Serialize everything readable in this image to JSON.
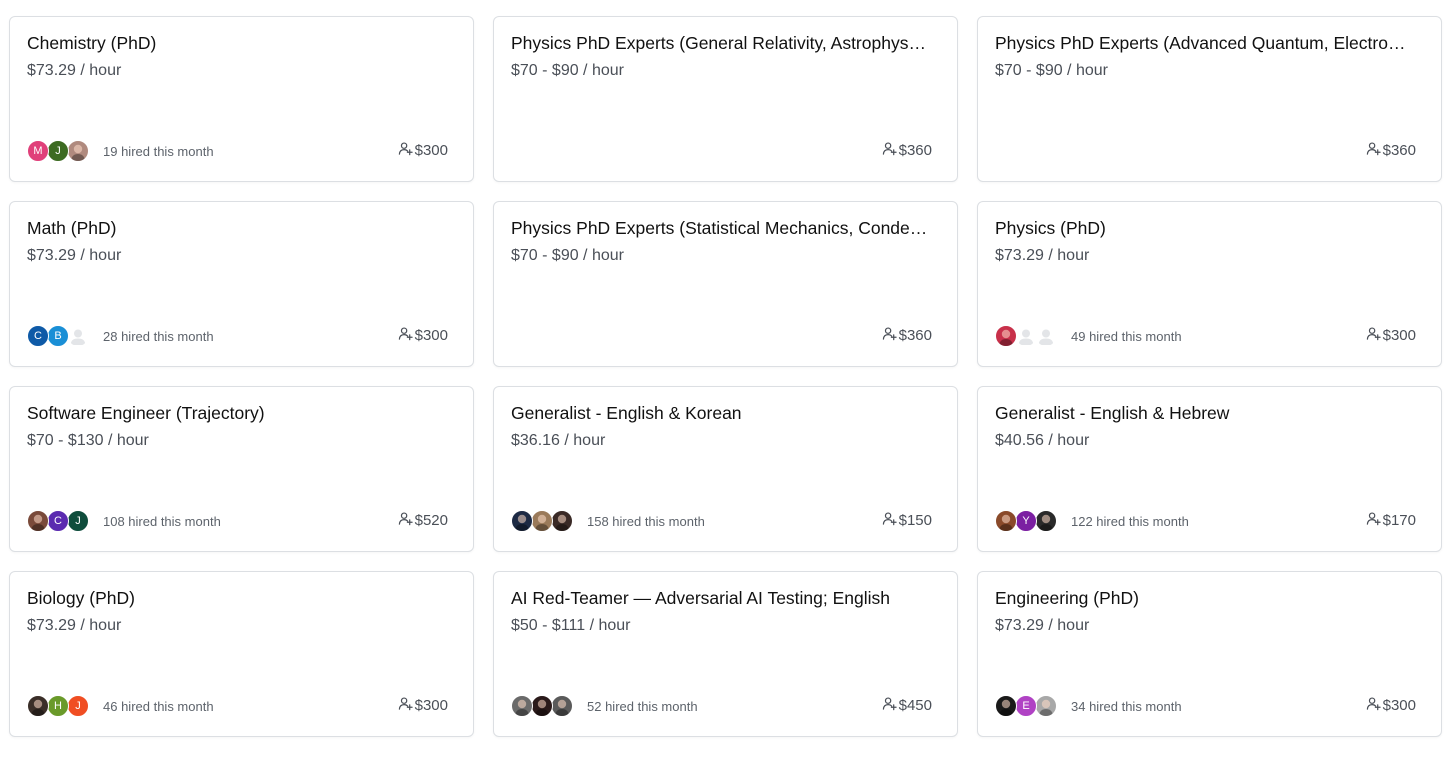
{
  "cards": [
    {
      "title": "Chemistry (PhD)",
      "rate": "$73.29 / hour",
      "hired": "19 hired this month",
      "referral": "$300",
      "avatars": [
        {
          "kind": "letter",
          "letter": "M",
          "color": "#e0407a"
        },
        {
          "kind": "letter",
          "letter": "J",
          "color": "#3d6b22"
        },
        {
          "kind": "photo",
          "color": "#b08a7e"
        }
      ]
    },
    {
      "title": "Physics PhD Experts (General Relativity, Astrophysics…",
      "rate": "$70 - $90 / hour",
      "hired": "",
      "referral": "$360",
      "avatars": []
    },
    {
      "title": "Physics PhD Experts (Advanced Quantum, Electrodyn…",
      "rate": "$70 - $90 / hour",
      "hired": "",
      "referral": "$360",
      "avatars": []
    },
    {
      "title": "Math (PhD)",
      "rate": "$73.29 / hour",
      "hired": "28 hired this month",
      "referral": "$300",
      "avatars": [
        {
          "kind": "letter",
          "letter": "C",
          "color": "#0e5aa7"
        },
        {
          "kind": "letter",
          "letter": "B",
          "color": "#1a8fd6"
        },
        {
          "kind": "placeholder",
          "color": "#e3e5e8"
        }
      ]
    },
    {
      "title": "Physics PhD Experts (Statistical Mechanics, Condens…",
      "rate": "$70 - $90 / hour",
      "hired": "",
      "referral": "$360",
      "avatars": []
    },
    {
      "title": "Physics (PhD)",
      "rate": "$73.29 / hour",
      "hired": "49 hired this month",
      "referral": "$300",
      "avatars": [
        {
          "kind": "photo",
          "color": "#c8304a"
        },
        {
          "kind": "placeholder",
          "color": "#e3e5e8"
        },
        {
          "kind": "placeholder",
          "color": "#e3e5e8"
        }
      ]
    },
    {
      "title": "Software Engineer (Trajectory)",
      "rate": "$70 - $130 / hour",
      "hired": "108 hired this month",
      "referral": "$520",
      "avatars": [
        {
          "kind": "photo",
          "color": "#7a4a3a"
        },
        {
          "kind": "letter",
          "letter": "C",
          "color": "#5b2bb0"
        },
        {
          "kind": "letter",
          "letter": "J",
          "color": "#0f4d3c"
        }
      ]
    },
    {
      "title": "Generalist - English & Korean",
      "rate": "$36.16 / hour",
      "hired": "158 hired this month",
      "referral": "$150",
      "avatars": [
        {
          "kind": "photo",
          "color": "#1d2a44"
        },
        {
          "kind": "photo",
          "color": "#9a7a5a"
        },
        {
          "kind": "photo",
          "color": "#3a2a26"
        }
      ]
    },
    {
      "title": "Generalist - English & Hebrew",
      "rate": "$40.56 / hour",
      "hired": "122 hired this month",
      "referral": "$170",
      "avatars": [
        {
          "kind": "photo",
          "color": "#8a4a2a"
        },
        {
          "kind": "letter",
          "letter": "Y",
          "color": "#7b1fa2"
        },
        {
          "kind": "photo",
          "color": "#2a2a2a"
        }
      ]
    },
    {
      "title": "Biology (PhD)",
      "rate": "$73.29 / hour",
      "hired": "46 hired this month",
      "referral": "$300",
      "avatars": [
        {
          "kind": "photo",
          "color": "#3a2e28"
        },
        {
          "kind": "letter",
          "letter": "H",
          "color": "#6a9a2a"
        },
        {
          "kind": "letter",
          "letter": "J",
          "color": "#f04e23"
        }
      ]
    },
    {
      "title": "AI Red-Teamer — Adversarial AI Testing; English",
      "rate": "$50 - $111 / hour",
      "hired": "52 hired this month",
      "referral": "$450",
      "avatars": [
        {
          "kind": "photo",
          "color": "#6a6a6a"
        },
        {
          "kind": "photo",
          "color": "#2a1a1a"
        },
        {
          "kind": "photo",
          "color": "#5a5a5a"
        }
      ]
    },
    {
      "title": "Engineering (PhD)",
      "rate": "$73.29 / hour",
      "hired": "34 hired this month",
      "referral": "$300",
      "avatars": [
        {
          "kind": "photo",
          "color": "#1a1a1a"
        },
        {
          "kind": "letter",
          "letter": "E",
          "color": "#b042c4"
        },
        {
          "kind": "photo",
          "color": "#a8a8a8"
        }
      ]
    }
  ]
}
